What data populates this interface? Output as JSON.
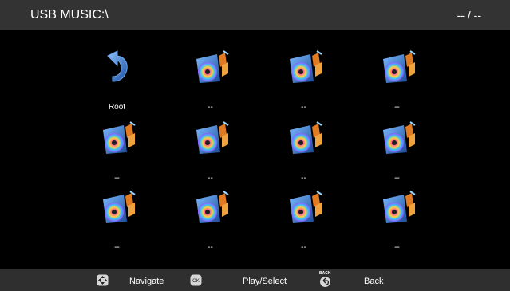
{
  "header": {
    "title": "USB MUSIC:\\",
    "page_indicator": "-- / --"
  },
  "grid": {
    "items": [
      {
        "type": "root",
        "label": "Root",
        "icon": "return-arrow-icon"
      },
      {
        "type": "music",
        "label": "--",
        "icon": "music-file-icon"
      },
      {
        "type": "music",
        "label": "--",
        "icon": "music-file-icon"
      },
      {
        "type": "music",
        "label": "--",
        "icon": "music-file-icon"
      },
      {
        "type": "music",
        "label": "--",
        "icon": "music-file-icon"
      },
      {
        "type": "music",
        "label": "--",
        "icon": "music-file-icon"
      },
      {
        "type": "music",
        "label": "--",
        "icon": "music-file-icon"
      },
      {
        "type": "music",
        "label": "--",
        "icon": "music-file-icon"
      },
      {
        "type": "music",
        "label": "--",
        "icon": "music-file-icon"
      },
      {
        "type": "music",
        "label": "--",
        "icon": "music-file-icon"
      },
      {
        "type": "music",
        "label": "--",
        "icon": "music-file-icon"
      },
      {
        "type": "music",
        "label": "--",
        "icon": "music-file-icon"
      }
    ]
  },
  "footer": {
    "navigate_label": "Navigate",
    "ok_icon_text": "OK",
    "play_select_label": "Play/Select",
    "back_icon_caption": "BACK",
    "back_label": "Back"
  },
  "colors": {
    "background": "#000000",
    "header_bar": "#333333",
    "footer_bar": "#2f2f2f",
    "root_arrow": "#3f7fd0"
  }
}
